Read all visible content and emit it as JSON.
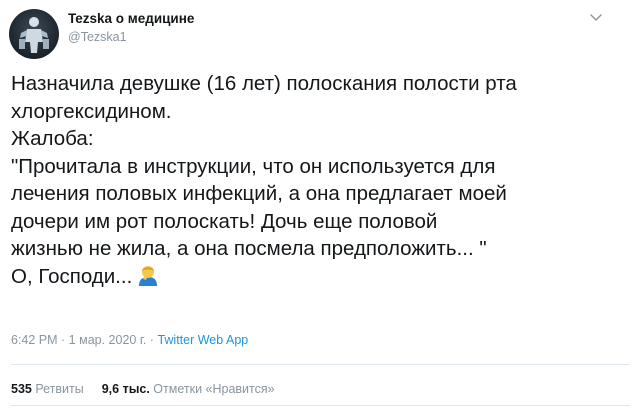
{
  "author": {
    "display_name": "Tezska о медицине",
    "handle": "@Tezska1"
  },
  "menu": {
    "icon": "chevron-down-icon"
  },
  "tweet": {
    "lines": [
      "Назначила девушке (16 лет) полоскания полости рта",
      "хлоргексидином.",
      "Жалоба:",
      "\"Прочитала в инструкции, что он используется для",
      "лечения половых инфекций, а она предлагает моей",
      "дочери им рот полоскать! Дочь еще половой",
      "жизнью не жила, а она посмела предположить... \"",
      "О, Господи..."
    ],
    "emoji": "person-facepalming-icon"
  },
  "meta": {
    "time": "6:42 PM",
    "separator": " · ",
    "date": "1 мар. 2020 г.",
    "via": "Twitter Web App"
  },
  "stats": {
    "retweets_count": "535",
    "retweets_label": "Ретвиты",
    "likes_count": "9,6 тыс.",
    "likes_label": "Отметки «Нравится»"
  },
  "colors": {
    "text": "#14171a",
    "muted": "#8a959e",
    "link": "#1b95e0",
    "divider": "#e1e8ed"
  }
}
